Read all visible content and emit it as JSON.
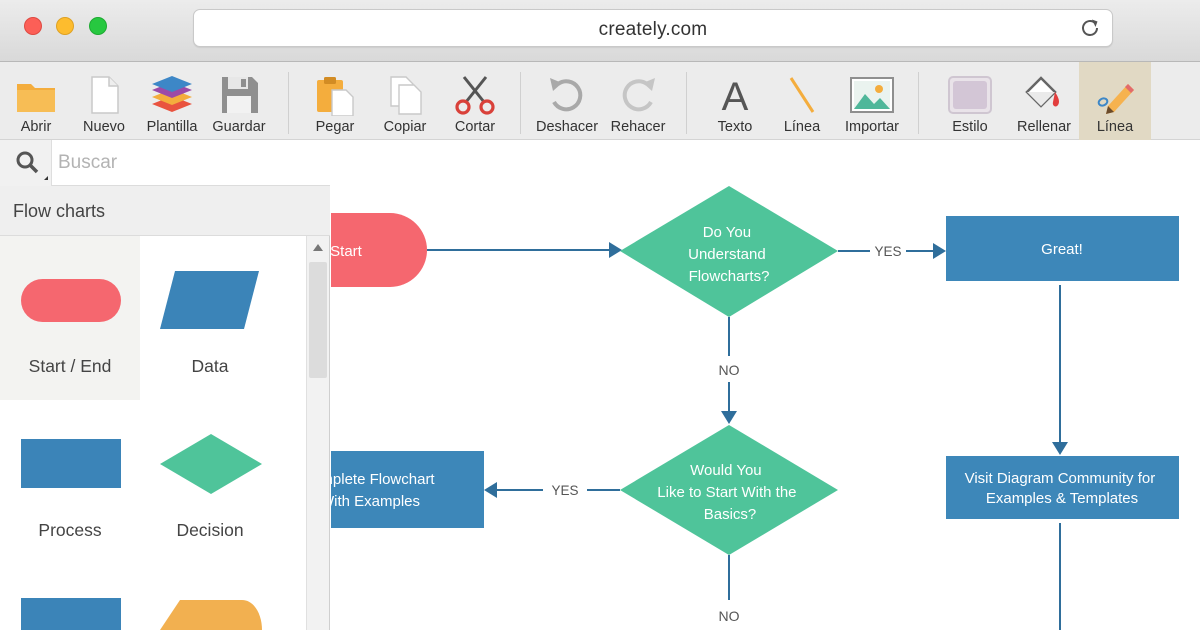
{
  "browser": {
    "url": "creately.com"
  },
  "toolbar": {
    "abrir": "Abrir",
    "nuevo": "Nuevo",
    "plantilla": "Plantilla",
    "guardar": "Guardar",
    "pegar": "Pegar",
    "copiar": "Copiar",
    "cortar": "Cortar",
    "deshacer": "Deshacer",
    "rehacer": "Rehacer",
    "texto": "Texto",
    "linea": "Línea",
    "importar": "Importar",
    "estilo": "Estilo",
    "rellenar": "Rellenar",
    "linea_pen": "Línea"
  },
  "panel": {
    "search_placeholder": "Buscar",
    "section": "Flow charts",
    "shapes": [
      "Start / End",
      "Data",
      "Process",
      "Decision"
    ]
  },
  "canvas": {
    "start": "Start",
    "decision1": [
      "Do You",
      "Understand",
      "Flowcharts?"
    ],
    "yes1": "YES",
    "great": "Great!",
    "no1": "NO",
    "decision2": [
      "Would You",
      "Like to Start  With the",
      "Basics?"
    ],
    "yes2": "YES",
    "complete": [
      "Complete Flowchart",
      "With Examples"
    ],
    "visit": [
      "Visit Diagram Community for",
      "Examples & Templates"
    ],
    "no2": "NO"
  },
  "colors": {
    "terminator": "#f5676f",
    "decision": "#4fc49a",
    "process": "#3d87b9",
    "connector": "#2f6e9b",
    "data_shape": "#3b84b8",
    "other_shape": "#f2b050"
  }
}
